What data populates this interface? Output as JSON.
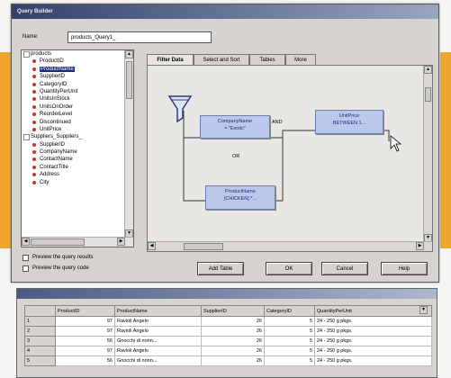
{
  "dialog": {
    "title": "Query Builder",
    "name_label": "Name:",
    "name_value": "products_Query1_"
  },
  "tree": {
    "items": [
      {
        "kind": "group",
        "label": "products"
      },
      {
        "kind": "field",
        "label": "ProductID"
      },
      {
        "kind": "field",
        "label": "ProductName",
        "selected": true
      },
      {
        "kind": "field",
        "label": "SupplierID"
      },
      {
        "kind": "field",
        "label": "CategoryID"
      },
      {
        "kind": "field",
        "label": "QuantityPerUnit"
      },
      {
        "kind": "field",
        "label": "UnitsInStock"
      },
      {
        "kind": "field",
        "label": "UnitsOnOrder"
      },
      {
        "kind": "field",
        "label": "ReorderLevel"
      },
      {
        "kind": "field",
        "label": "Discontinued"
      },
      {
        "kind": "field",
        "label": "UnitPrice"
      },
      {
        "kind": "group",
        "label": "Suppliers_Suppliers_"
      },
      {
        "kind": "field",
        "label": "SupplierID"
      },
      {
        "kind": "field",
        "label": "CompanyName"
      },
      {
        "kind": "field",
        "label": "ContactName"
      },
      {
        "kind": "field",
        "label": "ContactTitle"
      },
      {
        "kind": "field",
        "label": "Address"
      },
      {
        "kind": "field",
        "label": "City"
      }
    ]
  },
  "tabs": [
    "Filter Data",
    "Select and Sort",
    "Tables",
    "More"
  ],
  "filter_nodes": {
    "company": {
      "line1": "CompanyName",
      "line2": "= \"Exotic\""
    },
    "unit_price": {
      "line1": "UnitPrice",
      "line2": "BETWEEN 1..."
    },
    "product": {
      "line1": "ProductName",
      "line2": "[CHICKEN] *..."
    },
    "and_label": "AND",
    "or_label": "OR"
  },
  "options": {
    "preview_results": "Preview the query results",
    "preview_code": "Preview the query code"
  },
  "buttons": {
    "add_table": "Add Table",
    "ok": "OK",
    "cancel": "Cancel",
    "help": "Help"
  },
  "results": {
    "columns": [
      "",
      "ProductID",
      "ProductName",
      "SupplierID",
      "CategoryID",
      "QuantityPerUnit"
    ],
    "rows": [
      [
        "1",
        "97",
        "Ravioli Angelo",
        "26",
        "5",
        "24 - 250 g pkgs."
      ],
      [
        "2",
        "97",
        "Ravioli Angelo",
        "26",
        "5",
        "24 - 250 g pkgs."
      ],
      [
        "3",
        "56",
        "Gnocchi di nonn...",
        "26",
        "5",
        "24 - 250 g pkgs."
      ],
      [
        "4",
        "97",
        "Ravioli Angelo",
        "26",
        "5",
        "24 - 250 g pkgs."
      ],
      [
        "5",
        "56",
        "Gnocchi di nonn...",
        "26",
        "5",
        "24 - 250 g pkgs."
      ]
    ]
  },
  "colors": {
    "accent_orange": "#efa62c",
    "node_fill": "#b9c8eb",
    "selection": "#1d2b74"
  }
}
